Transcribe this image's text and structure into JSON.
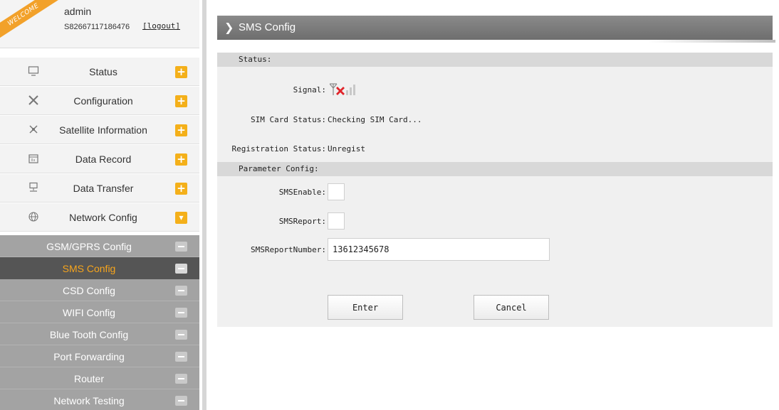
{
  "user": {
    "welcome": "WELCOME",
    "name": "admin",
    "serial": "S82667117186476",
    "logout": "[logout]"
  },
  "menu": [
    {
      "label": "Status",
      "icon": "monitor-icon",
      "toggle": "+"
    },
    {
      "label": "Configuration",
      "icon": "tools-icon",
      "toggle": "+"
    },
    {
      "label": "Satellite Information",
      "icon": "satellite-icon",
      "toggle": "+"
    },
    {
      "label": "Data Record",
      "icon": "calendar-icon",
      "toggle": "+"
    },
    {
      "label": "Data Transfer",
      "icon": "network-icon",
      "toggle": "+"
    },
    {
      "label": "Network Config",
      "icon": "globe-icon",
      "toggle": "▾"
    }
  ],
  "submenu": [
    {
      "label": "GSM/GPRS Config"
    },
    {
      "label": "SMS Config",
      "active": true
    },
    {
      "label": "CSD Config"
    },
    {
      "label": "WIFI Config"
    },
    {
      "label": "Blue Tooth Config"
    },
    {
      "label": "Port Forwarding"
    },
    {
      "label": "Router"
    },
    {
      "label": "Network Testing"
    }
  ],
  "page": {
    "title": "SMS Config"
  },
  "status_section": {
    "header": "Status:",
    "signal_label": "Signal:",
    "sim_label": "SIM Card Status:",
    "sim_value": "Checking SIM Card...",
    "reg_label": "Registration Status:",
    "reg_value": "Unregist"
  },
  "param_section": {
    "header": "Parameter Config:",
    "sms_enable_label": "SMSEnable:",
    "sms_report_label": "SMSReport:",
    "sms_number_label": "SMSReportNumber:",
    "sms_number_value": "13612345678"
  },
  "buttons": {
    "enter": "Enter",
    "cancel": "Cancel"
  },
  "colors": {
    "accent": "#f4b01a",
    "active_text": "#f7a51c",
    "signal_error": "#e0242a"
  }
}
